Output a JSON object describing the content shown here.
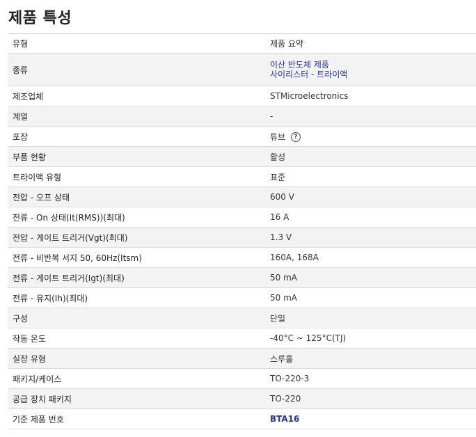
{
  "page_title": "제품 특성",
  "header": {
    "col1": "유형",
    "col2": "제품 요약"
  },
  "rows": [
    {
      "label": "종류",
      "values": [
        "이산 반도체 제품",
        "사이리스터 - 트라이액"
      ]
    },
    {
      "label": "제조업체",
      "value": "STMicroelectronics"
    },
    {
      "label": "계열",
      "value": "-"
    },
    {
      "label": "포장",
      "value": "튜브",
      "icon": "help-circle-icon"
    },
    {
      "label": "부품 현황",
      "value": "활성"
    },
    {
      "label": "트라이액 유형",
      "value": "표준"
    },
    {
      "label": "전압 - 오프 상태",
      "value": "600 V"
    },
    {
      "label": "전류 - On 상태(It(RMS))(최대)",
      "value": "16 A"
    },
    {
      "label": "전압 - 게이트 트리거(Vgt)(최대)",
      "value": "1.3 V"
    },
    {
      "label": "전류 - 비반복 서지 50, 60Hz(Itsm)",
      "value": "160A, 168A"
    },
    {
      "label": "전류 - 게이트 트리거(Igt)(최대)",
      "value": "50 mA"
    },
    {
      "label": "전류 - 유지(Ih)(최대)",
      "value": "50 mA"
    },
    {
      "label": "구성",
      "value": "단일"
    },
    {
      "label": "작동 온도",
      "value": "-40°C ~ 125°C(TJ)"
    },
    {
      "label": "실장 유형",
      "value": "스루홀"
    },
    {
      "label": "패키지/케이스",
      "value": "TO-220-3"
    },
    {
      "label": "공급 장치 패키지",
      "value": "TO-220"
    },
    {
      "label": "기준 제품 번호",
      "value": "BTA16"
    }
  ],
  "colors": {
    "link": "#1f37a8",
    "alt_row": "#f3f3f3",
    "border": "#dcdcdc"
  }
}
